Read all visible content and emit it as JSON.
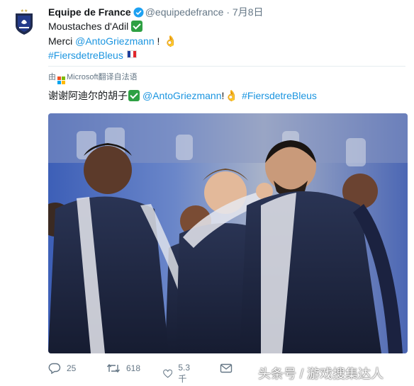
{
  "tweet": {
    "author_name": "Equipe de France",
    "handle": "@equipedefrance",
    "separator": "·",
    "date": "7月8日",
    "line1_text": "Moustaches d'Adil",
    "line2_prefix": "Merci ",
    "line2_mention": "@AntoGriezmann",
    "line2_suffix": " !",
    "hashtag": "#FiersdetreBleus",
    "translated_prefix": "由",
    "translated_brand": "Microsoft",
    "translated_suffix": "翻译自法语",
    "translation_text": "谢谢阿迪尔的胡子",
    "translation_mention": "@AntoGriezmann",
    "translation_bang": "!",
    "translation_hashtag": "#FiersdetreBleus"
  },
  "actions": {
    "reply_count": "25",
    "retweet_count": "618",
    "like_count": "5.3千"
  },
  "watermark": "头条号 / 游戏搜集达人",
  "colors": {
    "link": "#1b95e0",
    "verified": "#1da1f2",
    "muted": "#657786",
    "check_green": "#2ea043",
    "team_navy": "#1f2a4d"
  },
  "icons": [
    "team-logo-icon",
    "verified-icon",
    "check-mark-icon",
    "ok-hand-icon",
    "france-flag-icon",
    "microsoft-logo-icon",
    "reply-icon",
    "retweet-icon",
    "like-icon",
    "message-icon"
  ]
}
